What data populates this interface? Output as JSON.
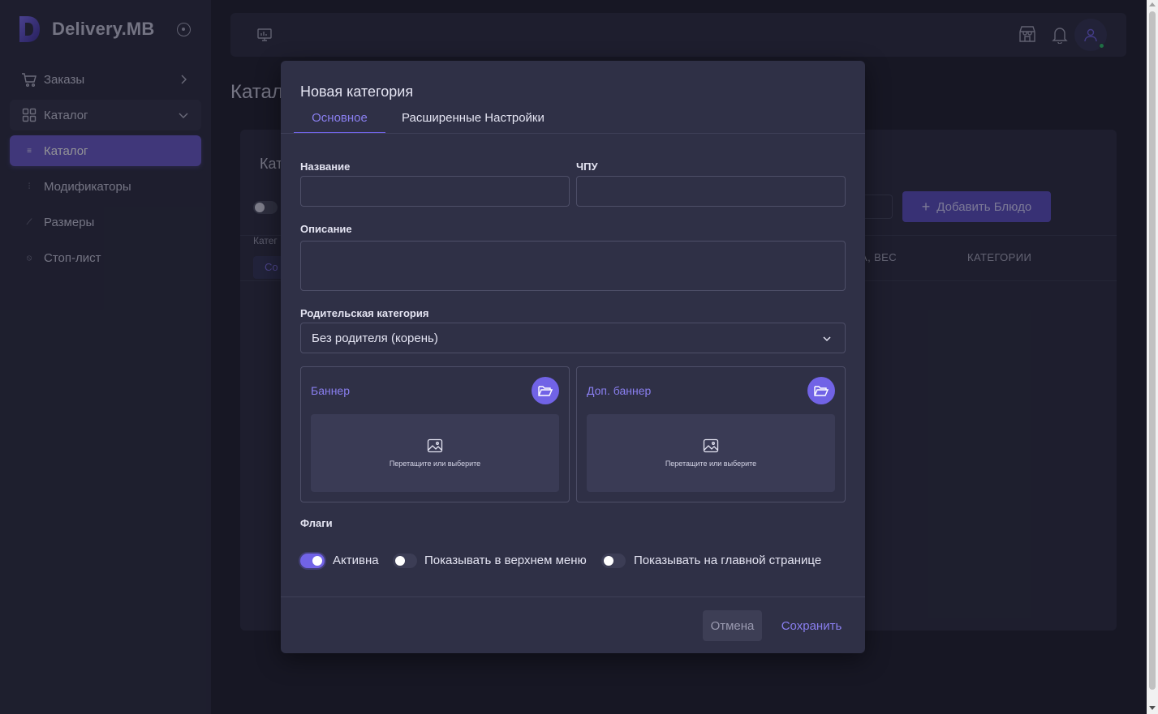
{
  "brand": {
    "name": "Delivery.MB"
  },
  "sidebar": {
    "items": [
      {
        "label": "Заказы"
      },
      {
        "label": "Каталог"
      },
      {
        "label": "Каталог"
      },
      {
        "label": "Модификаторы"
      },
      {
        "label": "Размеры"
      },
      {
        "label": "Стоп-лист"
      }
    ]
  },
  "background": {
    "page_title": "Катал",
    "card_title": "Кат",
    "category_label": "Катег",
    "category_chip": "Со",
    "add_button": "Добавить Блюдо",
    "columns": [
      "А, ВЕС",
      "КАТЕГОРИИ"
    ]
  },
  "modal": {
    "title": "Новая категория",
    "tabs": [
      "Основное",
      "Расширенные Настройки"
    ],
    "fields": {
      "name_label": "Название",
      "name_value": "",
      "slug_label": "ЧПУ",
      "slug_value": "",
      "description_label": "Описание",
      "description_value": "",
      "parent_label": "Родительская категория",
      "parent_value": "Без родителя (корень)"
    },
    "banners": [
      {
        "label": "Баннер",
        "hint": "Перетащите или выберите"
      },
      {
        "label": "Доп. баннер",
        "hint": "Перетащите или выберите"
      }
    ],
    "flags_label": "Флаги",
    "flags": [
      {
        "label": "Активна",
        "on": true
      },
      {
        "label": "Показывать в верхнем меню",
        "on": false
      },
      {
        "label": "Показывать на главной странице",
        "on": false
      }
    ],
    "cancel": "Отмена",
    "save": "Сохранить"
  },
  "colors": {
    "accent": "#6f62e3",
    "online": "#2ebd6b"
  }
}
